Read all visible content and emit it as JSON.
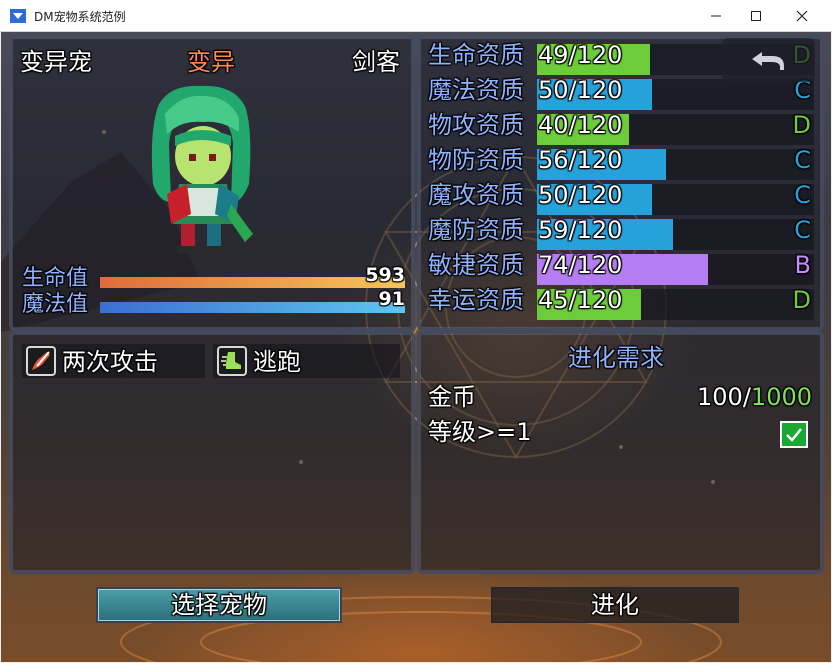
{
  "window": {
    "title": "DM宠物系统范例"
  },
  "pet": {
    "name": "变异宠",
    "state": "变异",
    "class": "剑客"
  },
  "stats": {
    "hp": {
      "label": "生命值",
      "value": "593",
      "ratio": 1.0
    },
    "mp": {
      "label": "魔法值",
      "value": "91",
      "ratio": 1.0
    }
  },
  "aptitudes": [
    {
      "label": "生命资质",
      "value": "49/120",
      "current": 49,
      "max": 120,
      "grade": "D",
      "fill_color": "#6ccc39",
      "grade_color": "#6ccc39"
    },
    {
      "label": "魔法资质",
      "value": "50/120",
      "current": 50,
      "max": 120,
      "grade": "C",
      "fill_color": "#27a1d9",
      "grade_color": "#27a1d9"
    },
    {
      "label": "物攻资质",
      "value": "40/120",
      "current": 40,
      "max": 120,
      "grade": "D",
      "fill_color": "#6ccc39",
      "grade_color": "#6ccc39"
    },
    {
      "label": "物防资质",
      "value": "56/120",
      "current": 56,
      "max": 120,
      "grade": "C",
      "fill_color": "#27a1d9",
      "grade_color": "#27a1d9"
    },
    {
      "label": "魔攻资质",
      "value": "50/120",
      "current": 50,
      "max": 120,
      "grade": "C",
      "fill_color": "#27a1d9",
      "grade_color": "#27a1d9"
    },
    {
      "label": "魔防资质",
      "value": "59/120",
      "current": 59,
      "max": 120,
      "grade": "C",
      "fill_color": "#27a1d9",
      "grade_color": "#27a1d9"
    },
    {
      "label": "敏捷资质",
      "value": "74/120",
      "current": 74,
      "max": 120,
      "grade": "B",
      "fill_color": "#b57df2",
      "grade_color": "#c78cff"
    },
    {
      "label": "幸运资质",
      "value": "45/120",
      "current": 45,
      "max": 120,
      "grade": "D",
      "fill_color": "#6ccc39",
      "grade_color": "#6ccc39"
    }
  ],
  "skills": [
    {
      "label": "两次攻击",
      "icon": "double-attack-icon"
    },
    {
      "label": "逃跑",
      "icon": "escape-boot-icon"
    }
  ],
  "evolution": {
    "title": "进化需求",
    "gold_label": "金币",
    "gold_current": "100",
    "gold_separator": "/",
    "gold_required": "1000",
    "level_label": "等级>=1",
    "level_met": true
  },
  "buttons": {
    "select_pet": "选择宠物",
    "evolve": "进化"
  }
}
